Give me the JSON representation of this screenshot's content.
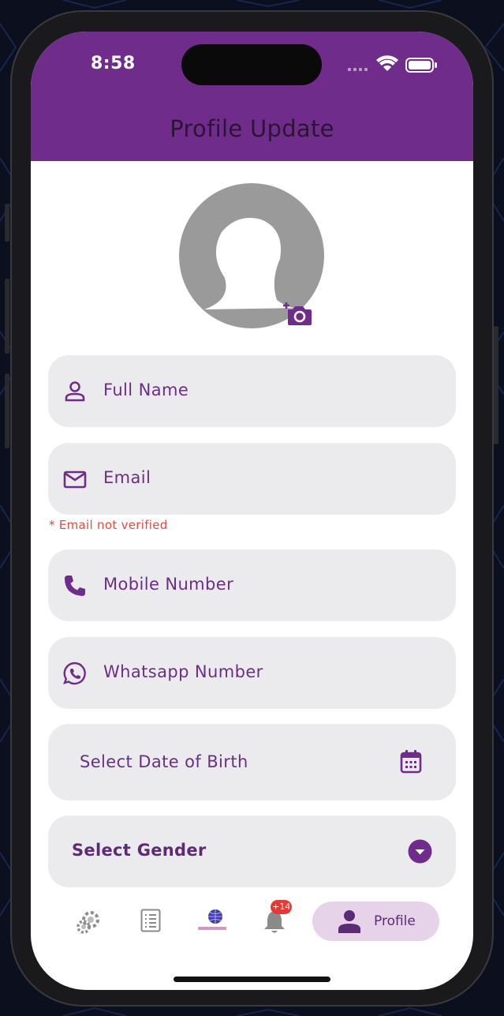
{
  "status_bar": {
    "time": "8:58"
  },
  "header": {
    "title": "Profile Update"
  },
  "form": {
    "full_name_placeholder": "Full Name",
    "email_placeholder": "Email",
    "email_error": "* Email not verified",
    "mobile_placeholder": "Mobile Number",
    "whatsapp_placeholder": "Whatsapp Number",
    "dob_placeholder": "Select Date of Birth",
    "gender_placeholder": "Select Gender"
  },
  "bottom_nav": {
    "items": [
      {
        "icon": "gear-icon"
      },
      {
        "icon": "list-icon"
      },
      {
        "icon": "service360-logo"
      },
      {
        "icon": "bell-icon",
        "badge": "+14"
      },
      {
        "icon": "person-icon",
        "label": "Profile",
        "active": true
      }
    ]
  },
  "colors": {
    "primary": "#6f2c8a",
    "field_bg": "#ebebee",
    "error": "#e04b3f",
    "active_pill": "#e6d3ea"
  }
}
